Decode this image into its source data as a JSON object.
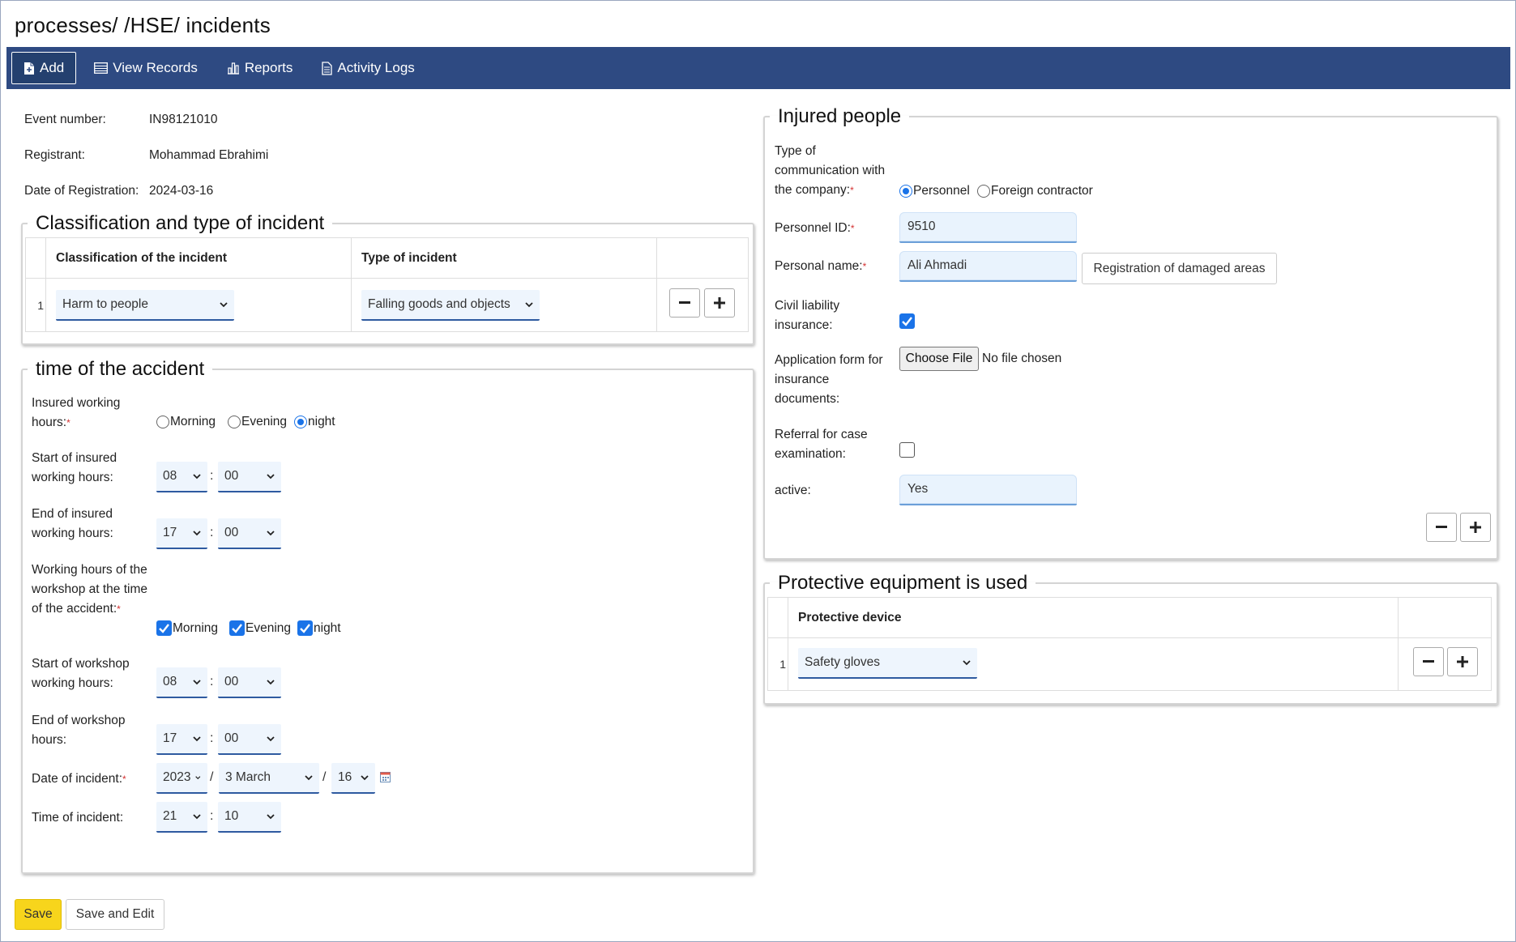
{
  "page": {
    "title": "processes/ /HSE/ incidents"
  },
  "nav": {
    "add": "Add",
    "view_records": "View Records",
    "reports": "Reports",
    "activity_logs": "Activity Logs"
  },
  "info": {
    "event_number_label": "Event number:",
    "event_number": "IN98121010",
    "registrant_label": "Registrant:",
    "registrant": "Mohammad Ebrahimi",
    "date_label": "Date of Registration:",
    "date": "2024-03-16"
  },
  "classification": {
    "legend": "Classification and type of incident",
    "col_classification": "Classification of the incident",
    "col_type": "Type of incident",
    "rows": [
      {
        "num": "1",
        "classification": "Harm to people",
        "type": "Falling goods and objects"
      }
    ]
  },
  "time": {
    "legend": "time of the accident",
    "insured_hours_label": "Insured working hours:",
    "shift_options": {
      "morning": "Morning",
      "evening": "Evening",
      "night": "night"
    },
    "insured_selected": "night",
    "start_insured_label": "Start of insured working hours:",
    "start_insured": {
      "hour": "08",
      "minute": "00"
    },
    "end_insured_label": "End of insured working hours:",
    "end_insured": {
      "hour": "17",
      "minute": "00"
    },
    "workshop_hours_label": "Working hours of the workshop at the time of the accident:",
    "workshop_checked": [
      "Morning",
      "Evening",
      "night"
    ],
    "start_workshop_label": "Start of workshop working hours:",
    "start_workshop": {
      "hour": "08",
      "minute": "00"
    },
    "end_workshop_label": "End of workshop hours:",
    "end_workshop": {
      "hour": "17",
      "minute": "00"
    },
    "date_incident_label": "Date of incident:",
    "date_incident": {
      "year": "2023",
      "month": "3 March",
      "day": "16"
    },
    "time_incident_label": "Time of incident:",
    "time_incident": {
      "hour": "21",
      "minute": "10"
    },
    "separator_colon": ":",
    "separator_slash": "/"
  },
  "injured": {
    "legend": "Injured people",
    "communication_label": "Type of communication with the company:",
    "communication_options": {
      "personnel": "Personnel",
      "contractor": "Foreign contractor"
    },
    "communication_selected": "Personnel",
    "personnel_id_label": "Personnel ID:",
    "personnel_id": "9510",
    "personal_name_label": "Personal name:",
    "personal_name": "Ali Ahmadi",
    "damaged_areas_button": "Registration of damaged areas",
    "civil_liability_label": "Civil liability insurance:",
    "civil_liability_checked": true,
    "application_form_label": "Application form for insurance documents:",
    "choose_file": "Choose File",
    "no_file": "No file chosen",
    "referral_label": "Referral for case examination:",
    "referral_checked": false,
    "active_label": "active:",
    "active": "Yes"
  },
  "protective": {
    "legend": "Protective equipment is used",
    "col_device": "Protective device",
    "rows": [
      {
        "num": "1",
        "device": "Safety gloves"
      }
    ]
  },
  "actions": {
    "save": "Save",
    "save_and_edit": "Save and Edit"
  },
  "colors": {
    "navbar": "#2e4a82",
    "save": "#f7d51c",
    "checkbox": "#1a73e8",
    "required": "#d43131"
  }
}
